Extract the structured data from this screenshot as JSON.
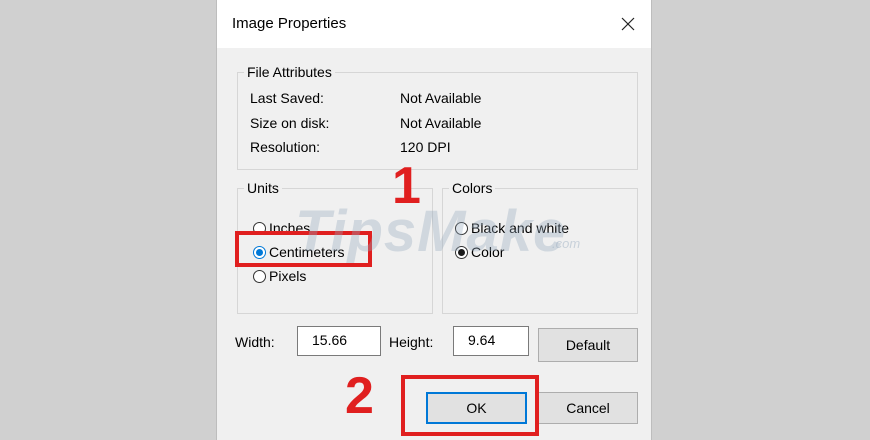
{
  "dialog": {
    "title": "Image Properties",
    "close_glyph": "✕"
  },
  "file_attributes": {
    "legend": "File Attributes",
    "rows": [
      {
        "label": "Last Saved:",
        "value": "Not Available"
      },
      {
        "label": "Size on disk:",
        "value": "Not Available"
      },
      {
        "label": "Resolution:",
        "value": "120 DPI"
      }
    ]
  },
  "units": {
    "legend": "Units",
    "options": [
      {
        "label": "Inches",
        "checked": false
      },
      {
        "label": "Centimeters",
        "checked": true
      },
      {
        "label": "Pixels",
        "checked": false
      }
    ]
  },
  "colors": {
    "legend": "Colors",
    "options": [
      {
        "label": "Black and white",
        "checked": false
      },
      {
        "label": "Color",
        "checked": true
      }
    ]
  },
  "dimensions": {
    "width_label": "Width:",
    "width_value": "15.66",
    "height_label": "Height:",
    "height_value": "9.64"
  },
  "buttons": {
    "default_label": "Default",
    "ok_label": "OK",
    "cancel_label": "Cancel"
  },
  "annotations": {
    "step1": "1",
    "step2": "2",
    "highlight_color": "#e01f1f"
  },
  "watermark": {
    "main": "TipsMake",
    "suffix": ".com"
  }
}
